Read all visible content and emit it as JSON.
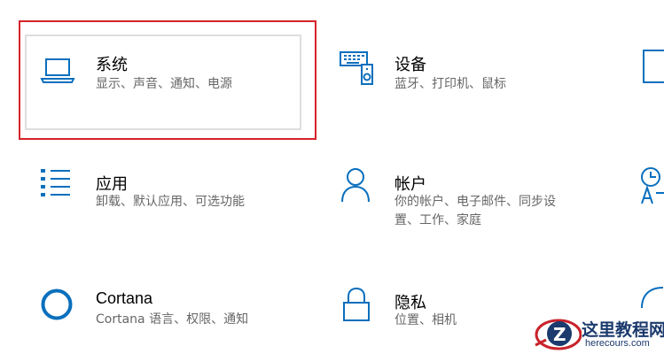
{
  "accent_color": "#0a6fbd",
  "selection_color": "#d5232b",
  "tiles": [
    {
      "title": "系统",
      "description": "显示、声音、通知、电源",
      "icon": "laptop-icon"
    },
    {
      "title": "设备",
      "description": "蓝牙、打印机、鼠标",
      "icon": "keyboard-speaker-icon"
    },
    {
      "title": "应用",
      "description": "卸载、默认应用、可选功能",
      "icon": "app-list-icon"
    },
    {
      "title": "帐户",
      "description": "你的帐户、电子邮件、同步设",
      "description_line2": "置、工作、家庭",
      "icon": "person-icon"
    },
    {
      "title": "Cortana",
      "description": "Cortana 语言、权限、通知",
      "icon": "cortana-ring-icon"
    },
    {
      "title": "隐私",
      "description": "位置、相机",
      "icon": "lock-icon"
    }
  ],
  "watermark": {
    "text": "这里教程网",
    "url": "herecours.com"
  }
}
